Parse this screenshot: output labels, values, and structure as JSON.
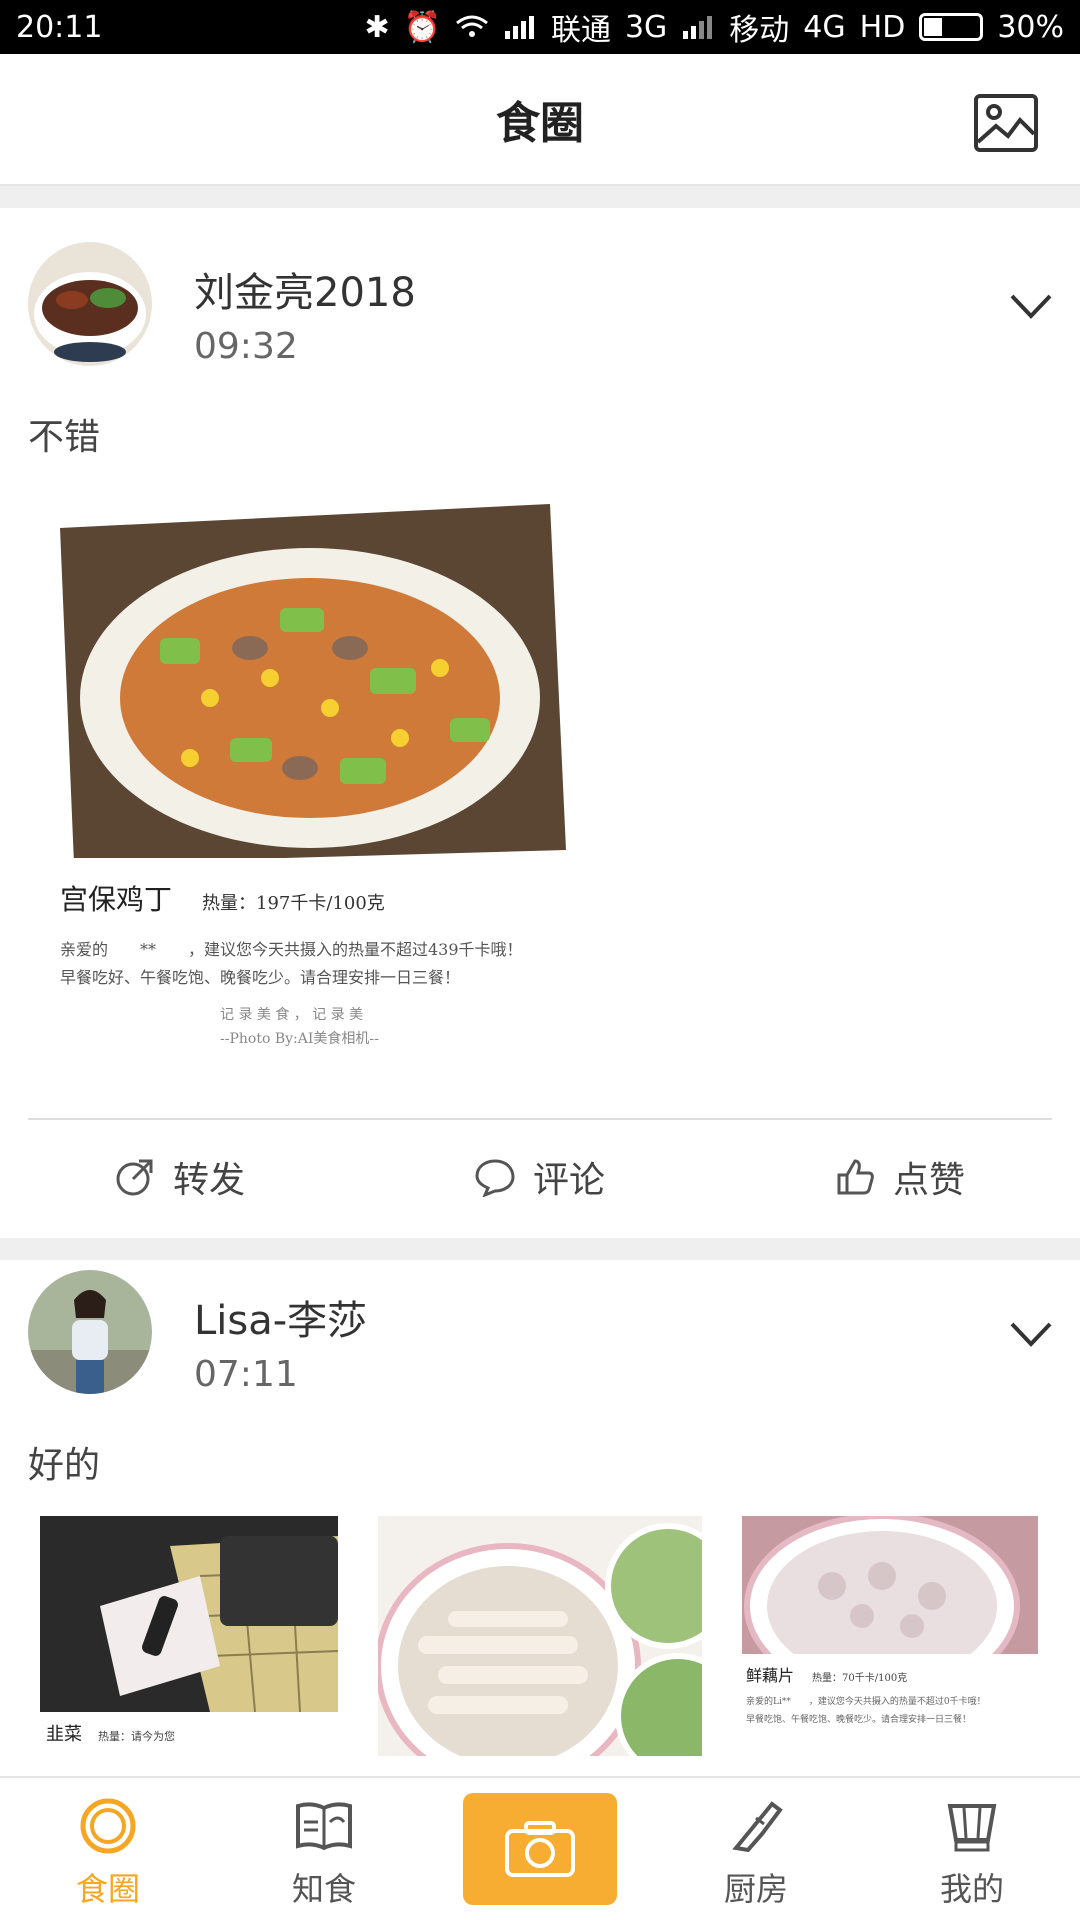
{
  "status_bar": {
    "time": "20:11",
    "carrier1": "联通",
    "net1": "3G",
    "carrier2": "移动",
    "net2": "4G",
    "hd": "HD",
    "battery": "30%"
  },
  "header": {
    "title": "食圈"
  },
  "posts": [
    {
      "user": "刘金亮2018",
      "time": "09:32",
      "text": "不错",
      "photo": {
        "dish": "宫保鸡丁",
        "calories": "热量：197千卡/100克",
        "line1": "亲爱的　　**　　，建议您今天共摄入的热量不超过439千卡哦！",
        "line2": "早餐吃好、午餐吃饱、晚餐吃少。请合理安排一日三餐！",
        "slogan": "记 录 美 食 ， 记 录 美",
        "credit": "--Photo By:AI美食相机--"
      },
      "actions": {
        "share": "转发",
        "comment": "评论",
        "like": "点赞"
      }
    },
    {
      "user": "Lisa-李莎",
      "time": "07:11",
      "text": "好的",
      "photos": [
        {
          "dish": "韭菜",
          "calories": "热量：请今为您"
        },
        {
          "dish": "",
          "calories": ""
        },
        {
          "dish": "鲜藕片",
          "calories": "热量：70千卡/100克",
          "line1": "亲爱的Li**　　，建议您今天共摄入的热量不超过0千卡哦！",
          "line2": "早餐吃饱、午餐吃饱、晚餐吃少。请合理安排一日三餐！"
        }
      ]
    }
  ],
  "nav": {
    "items": [
      "食圈",
      "知食",
      "厨房",
      "我的"
    ],
    "active": "食圈",
    "accent": "#f5a623"
  }
}
